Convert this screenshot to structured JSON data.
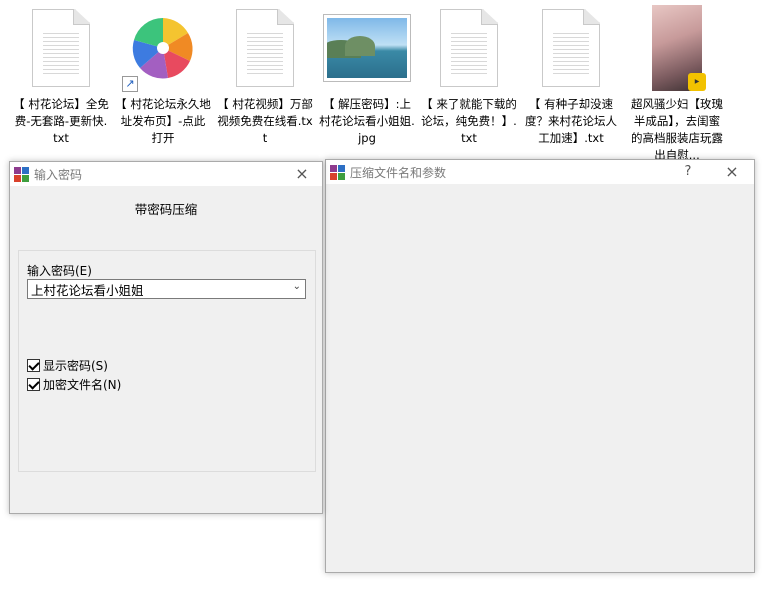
{
  "files": [
    {
      "type": "doc",
      "label": "【 村花论坛】全免费-无套路-更新快.txt"
    },
    {
      "type": "shortcut",
      "label": "【 村花论坛永久地址发布页】-点此打开"
    },
    {
      "type": "doc",
      "label": "【 村花视频】万部视频免费在线看.txt"
    },
    {
      "type": "image",
      "label": "【 解压密码】:上村花论坛看小姐姐.jpg"
    },
    {
      "type": "doc",
      "label": "【 来了就能下载的论坛，纯免费！】.txt"
    },
    {
      "type": "doc",
      "label": "【 有种子却没速度？来村花论坛人工加速】.txt"
    },
    {
      "type": "photo",
      "label": "超风骚少妇【玫瑰半成品】，去闺蜜的高档服装店玩露出自慰..."
    }
  ],
  "password_dialog": {
    "title": "输入密码",
    "close_icon": "×",
    "heading": "带密码压缩",
    "password_label": "输入密码(E)",
    "password_value": "上村花论坛看小姐姐",
    "show_password_label": "显示密码(S)",
    "show_password_checked": true,
    "encrypt_filenames_label": "加密文件名(N)",
    "encrypt_filenames_checked": true
  },
  "archive_dialog": {
    "title": "压缩文件名和参数",
    "help_icon": "?",
    "close_icon": "×"
  }
}
